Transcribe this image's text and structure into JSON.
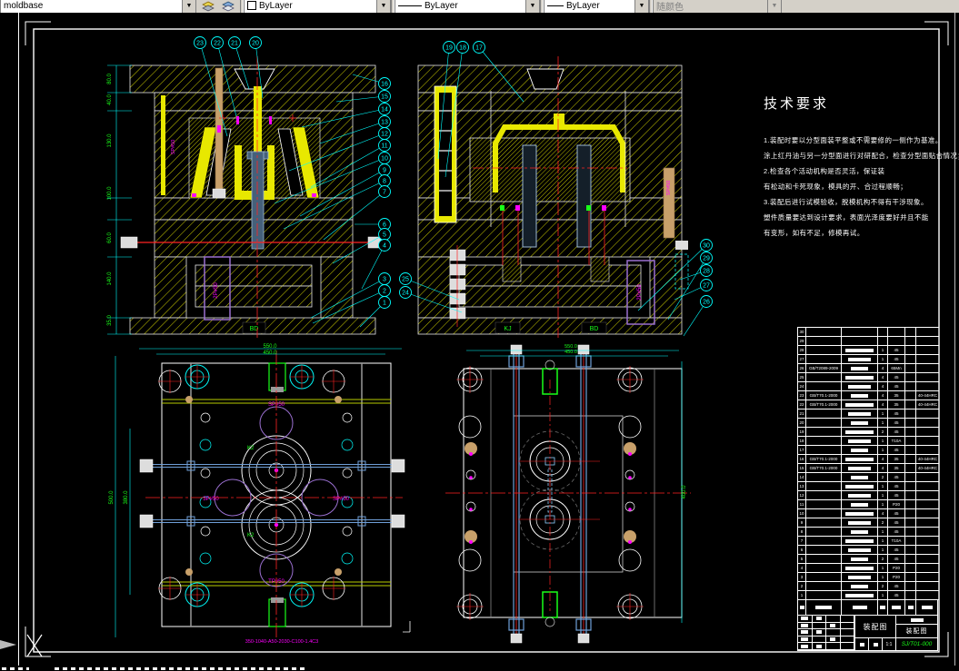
{
  "toolbar": {
    "layer_value": "moldbase",
    "color_value": "ByLayer",
    "linetype_value": "ByLayer",
    "lineweight_value": "ByLayer",
    "plotstyle_value": "随颜色"
  },
  "tech_req": {
    "title": "技术要求",
    "lines": [
      "1.装配时要以分型面装平整或不需要修的一侧作为基准。",
      "涂上红丹油与另一分型面进行对研配合，检查分型面贴合情况；",
      "2.检查各个活动机构是否灵活，保证装",
      "有松动和卡死现象，模具的开、合过程顺畅；",
      "3.装配后进行试模验收，脱模机构不得有干涉现象。",
      "塑件质量要达到设计要求，表面光泽度要好并且不能",
      "有变形，如有不足，修模再试。"
    ]
  },
  "views": {
    "sec_left": {
      "balloons_top": [
        "23",
        "22",
        "21",
        "20"
      ],
      "balloons_right": [
        "16",
        "15",
        "14",
        "13",
        "12",
        "11",
        "10",
        "9",
        "8",
        "7",
        "6",
        "5",
        "4",
        "3",
        "2",
        "1"
      ],
      "dims_left": [
        "80.0",
        "40.0",
        "130.0",
        "100.0",
        "60.0",
        "140.0",
        "35.0"
      ],
      "bd_label": "BD",
      "cyl_label": "2P#50",
      "side_label": "SP#50"
    },
    "sec_right": {
      "balloons_top": [
        "19",
        "18",
        "17"
      ],
      "balloons_left": [
        "25",
        "24"
      ],
      "balloons_right": [
        "30",
        "29",
        "28",
        "27",
        "26"
      ],
      "kj_label": "KJ",
      "bd_label": "BD",
      "cyl_label": "2P#50",
      "side_label": "SP#50"
    },
    "plan_left": {
      "dim_top_outer": "550.0",
      "dim_top_inner": "450.0",
      "dim_left_outer": "500.0",
      "dim_left_inner": "380.0",
      "sp_top": "SP#50",
      "sp_left": "3P#50",
      "sp_right": "SP#50",
      "sp_bottom": "TP#50",
      "k_top": "K2",
      "k_bottom": "K2",
      "code_text": "350-1040-A50-2030-C100-1.4C3"
    },
    "plan_right": {
      "dim_top_outer": "550.0",
      "dim_top_inner": "450.0",
      "dim_right": "400.0"
    }
  },
  "bom": {
    "rows": [
      {
        "no": "30",
        "code": "",
        "qty": "",
        "mat": "",
        "remark": ""
      },
      {
        "no": "29",
        "code": "",
        "qty": "",
        "mat": "",
        "remark": ""
      },
      {
        "no": "28",
        "code": "",
        "qty": "1",
        "mat": "45",
        "remark": ""
      },
      {
        "no": "27",
        "code": "",
        "qty": "1",
        "mat": "45",
        "remark": ""
      },
      {
        "no": "26",
        "code": "GB/T2089-2009",
        "qty": "4",
        "mat": "65Mn",
        "remark": ""
      },
      {
        "no": "25",
        "code": "",
        "qty": "4",
        "mat": "45",
        "remark": ""
      },
      {
        "no": "24",
        "code": "",
        "qty": "4",
        "mat": "45",
        "remark": ""
      },
      {
        "no": "23",
        "code": "GB/T70.1-2000",
        "qty": "4",
        "mat": "35",
        "remark": "40-44HRC"
      },
      {
        "no": "22",
        "code": "GB/T70.1-2000",
        "qty": "4",
        "mat": "35",
        "remark": "40-44HRC"
      },
      {
        "no": "21",
        "code": "",
        "qty": "1",
        "mat": "45",
        "remark": ""
      },
      {
        "no": "20",
        "code": "",
        "qty": "1",
        "mat": "45",
        "remark": ""
      },
      {
        "no": "19",
        "code": "",
        "qty": "2",
        "mat": "45",
        "remark": ""
      },
      {
        "no": "18",
        "code": "",
        "qty": "1",
        "mat": "T10A",
        "remark": ""
      },
      {
        "no": "17",
        "code": "",
        "qty": "1",
        "mat": "45",
        "remark": ""
      },
      {
        "no": "16",
        "code": "GB/T70.1-2000",
        "qty": "4",
        "mat": "35",
        "remark": "40-44HRC"
      },
      {
        "no": "15",
        "code": "GB/T70.1-2000",
        "qty": "4",
        "mat": "35",
        "remark": "40-44HRC"
      },
      {
        "no": "14",
        "code": "",
        "qty": "2",
        "mat": "45",
        "remark": ""
      },
      {
        "no": "13",
        "code": "",
        "qty": "1",
        "mat": "45",
        "remark": ""
      },
      {
        "no": "12",
        "code": "",
        "qty": "1",
        "mat": "45",
        "remark": ""
      },
      {
        "no": "11",
        "code": "",
        "qty": "1",
        "mat": "P20",
        "remark": ""
      },
      {
        "no": "10",
        "code": "",
        "qty": "4",
        "mat": "45",
        "remark": ""
      },
      {
        "no": "9",
        "code": "",
        "qty": "2",
        "mat": "45",
        "remark": ""
      },
      {
        "no": "8",
        "code": "",
        "qty": "1",
        "mat": "45",
        "remark": ""
      },
      {
        "no": "7",
        "code": "",
        "qty": "1",
        "mat": "T10A",
        "remark": ""
      },
      {
        "no": "6",
        "code": "",
        "qty": "1",
        "mat": "45",
        "remark": ""
      },
      {
        "no": "5",
        "code": "",
        "qty": "2",
        "mat": "45",
        "remark": ""
      },
      {
        "no": "4",
        "code": "",
        "qty": "1",
        "mat": "P20",
        "remark": ""
      },
      {
        "no": "3",
        "code": "",
        "qty": "1",
        "mat": "P20",
        "remark": ""
      },
      {
        "no": "2",
        "code": "",
        "qty": "2",
        "mat": "45",
        "remark": ""
      },
      {
        "no": "1",
        "code": "",
        "qty": "1",
        "mat": "45",
        "remark": ""
      }
    ]
  },
  "title_block": {
    "name": "装配图",
    "name2": "装配图",
    "scale": "1:1",
    "code": "SJ/T01-000"
  },
  "colors": {
    "hatch": "#d9d900",
    "balloon": "#00ffff",
    "dim_text": "#19ff19",
    "centerline": "#ff2222",
    "magenta": "#ff00ff",
    "purple": "#9a6fd0",
    "tan": "#c8a06a",
    "steel": "#45607a",
    "code_green": "#19ff19"
  }
}
